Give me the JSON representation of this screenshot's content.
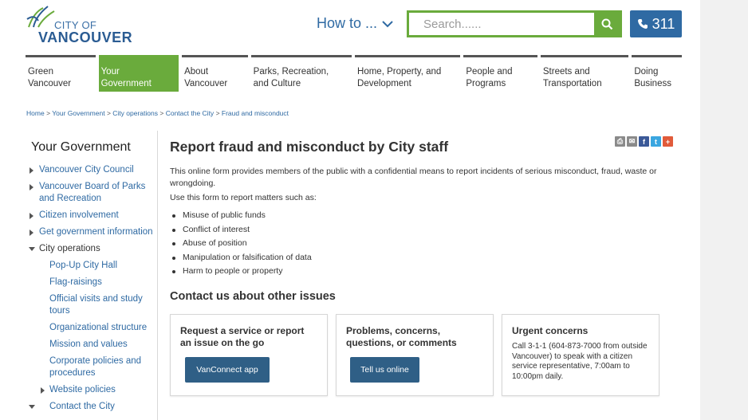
{
  "header": {
    "logo_city": "CITY OF",
    "logo_vancouver": "VANCOUVER",
    "howto_label": "How to ...",
    "search_placeholder": "Search......",
    "btn_311_label": "311"
  },
  "nav": [
    {
      "line1": "Green",
      "line2": "Vancouver",
      "active": false
    },
    {
      "line1": "Your",
      "line2": "Government",
      "active": true
    },
    {
      "line1": "About",
      "line2": "Vancouver",
      "active": false
    },
    {
      "line1": "Parks, Recreation,",
      "line2": "and Culture",
      "active": false
    },
    {
      "line1": "Home, Property, and",
      "line2": "Development",
      "active": false
    },
    {
      "line1": "People and",
      "line2": "Programs",
      "active": false
    },
    {
      "line1": "Streets and",
      "line2": "Transportation",
      "active": false
    },
    {
      "line1": "Doing",
      "line2": "Business",
      "active": false
    }
  ],
  "breadcrumb": [
    "Home",
    "Your Government",
    "City operations",
    "Contact the City",
    "Fraud and misconduct"
  ],
  "breadcrumb_sep": ">",
  "sidebar": {
    "title": "Your Government",
    "items": [
      {
        "label": "Vancouver City Council",
        "level": 1,
        "arrow": "right"
      },
      {
        "label": "Vancouver Board of Parks and Recreation",
        "level": 1,
        "arrow": "right"
      },
      {
        "label": "Citizen involvement",
        "level": 1,
        "arrow": "right"
      },
      {
        "label": "Get government information",
        "level": 1,
        "arrow": "right"
      },
      {
        "label": "City operations",
        "level": 1,
        "arrow": "down"
      },
      {
        "label": "Pop-Up City Hall",
        "level": 2,
        "arrow": ""
      },
      {
        "label": "Flag-raisings",
        "level": 2,
        "arrow": ""
      },
      {
        "label": "Official visits and study tours",
        "level": 2,
        "arrow": ""
      },
      {
        "label": "Organizational structure",
        "level": 2,
        "arrow": ""
      },
      {
        "label": "Mission and values",
        "level": 2,
        "arrow": ""
      },
      {
        "label": "Corporate policies and procedures",
        "level": 2,
        "arrow": ""
      },
      {
        "label": "Website policies",
        "level": 2,
        "arrow": "right"
      },
      {
        "label": "Contact the City",
        "level": 2,
        "arrow": "down"
      }
    ]
  },
  "content": {
    "title": "Report fraud and misconduct by City staff",
    "intro": "This online form provides members of the public with a confidential means to report incidents of serious misconduct, fraud, waste or wrongdoing.",
    "use_line": "Use this form to report matters such as:",
    "bullets": [
      "Misuse of public funds",
      "Conflict of interest",
      "Abuse of position",
      "Manipulation or falsification of data",
      "Harm to people or property"
    ],
    "contact_title": "Contact us about other issues",
    "cards": [
      {
        "title": "Request a service or report an issue on the go",
        "button": "VanConnect app"
      },
      {
        "title": "Problems, concerns, questions, or comments",
        "button": "Tell us online"
      },
      {
        "title": "Urgent concerns",
        "text": "Call 3-1-1 (604-873-7000 from outside Vancouver) to speak with a citizen service representative, 7:00am to 10:00pm daily."
      }
    ]
  },
  "share": {
    "print_color": "#8a8a8a",
    "email_color": "#8a8a8a",
    "facebook_color": "#3b5998",
    "twitter_color": "#3aa6e0",
    "more_color": "#e15b3a"
  },
  "colors": {
    "brand_green": "#6aab3c",
    "brand_blue": "#2f6aa3",
    "button_blue": "#2f5f86"
  }
}
